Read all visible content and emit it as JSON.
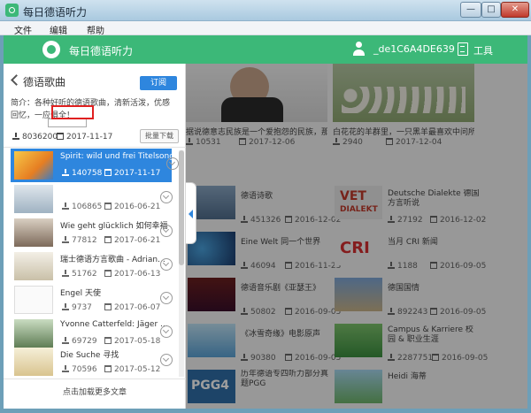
{
  "window": {
    "title": "每日德语听力",
    "minimize": "—",
    "maximize": "□",
    "close": "✕"
  },
  "menu": {
    "file": "文件",
    "edit": "编辑",
    "help": "帮助"
  },
  "appbar": {
    "brand": "每日德语听力",
    "username": "_de1C6A4DE639",
    "tools": "工具"
  },
  "panel": {
    "title": "德语歌曲",
    "subscribe": "订阅",
    "description": "简介：各种好听的德语歌曲，清新活泼，优感回忆，一应俱全！",
    "downloads": "8036200",
    "date": "2017-11-17",
    "batch_download": "批量下载",
    "load_more": "点击加载更多文章",
    "songs": [
      {
        "title": "Spirit: wild und frei Titelsong",
        "downloads": "140758",
        "date": "2017-11-17"
      },
      {
        "title": "",
        "downloads": "106865",
        "date": "2016-06-21"
      },
      {
        "title": "Wie geht glücklich 如何幸福",
        "downloads": "77812",
        "date": "2017-06-21"
      },
      {
        "title": "瑞士德语方言歌曲 - Adrian...",
        "downloads": "51762",
        "date": "2017-06-13"
      },
      {
        "title": "Engel 天使",
        "downloads": "9737",
        "date": "2017-06-07"
      },
      {
        "title": "Yvonne Catterfeld: Jäger ...",
        "downloads": "69729",
        "date": "2017-05-18"
      },
      {
        "title": "Die Suche 寻找",
        "downloads": "70596",
        "date": "2017-05-12"
      }
    ]
  },
  "main": {
    "top_cards": [
      {
        "title": "据说德意志民族是一个爱抱怨的民族，那你...",
        "downloads": "10531",
        "date": "2017-12-06"
      },
      {
        "title": "白花花的羊群里，一只黑羊最喜欢中问所",
        "downloads": "2940",
        "date": "2017-12-04"
      }
    ],
    "cards": [
      {
        "title": "德语诗歌",
        "downloads": "451326",
        "date": "2016-12-02"
      },
      {
        "title": "Deutsche Dialekte 德国方言听说",
        "downloads": "27192",
        "date": "2016-12-02"
      },
      {
        "title": "Eine Welt 同一个世界",
        "downloads": "46094",
        "date": "2016-11-23"
      },
      {
        "title": "当月 CRI 新闻",
        "downloads": "1188",
        "date": "2016-09-05"
      },
      {
        "title": "德语音乐剧《亚瑟王》",
        "downloads": "50802",
        "date": "2016-09-05"
      },
      {
        "title": "德国国情",
        "downloads": "892243",
        "date": "2016-09-05"
      },
      {
        "title": "《冰雪奇缘》电影原声",
        "downloads": "90380",
        "date": "2016-09-05"
      },
      {
        "title": "Campus & Karriere 校园 & 职业生涯",
        "downloads": "2287751",
        "date": "2016-09-05"
      },
      {
        "title": "历年德语专四听力部分真题PGG",
        "downloads": "",
        "date": ""
      },
      {
        "title": "Heidi 海蒂",
        "downloads": "",
        "date": ""
      }
    ],
    "thumb_labels": {
      "vet": "VET",
      "dialekt": "DIALEKT",
      "cri": "CRI",
      "pgg": "PGG4"
    }
  },
  "colors": {
    "accent_green": "#3cb878",
    "selection_blue": "#2e86de"
  }
}
